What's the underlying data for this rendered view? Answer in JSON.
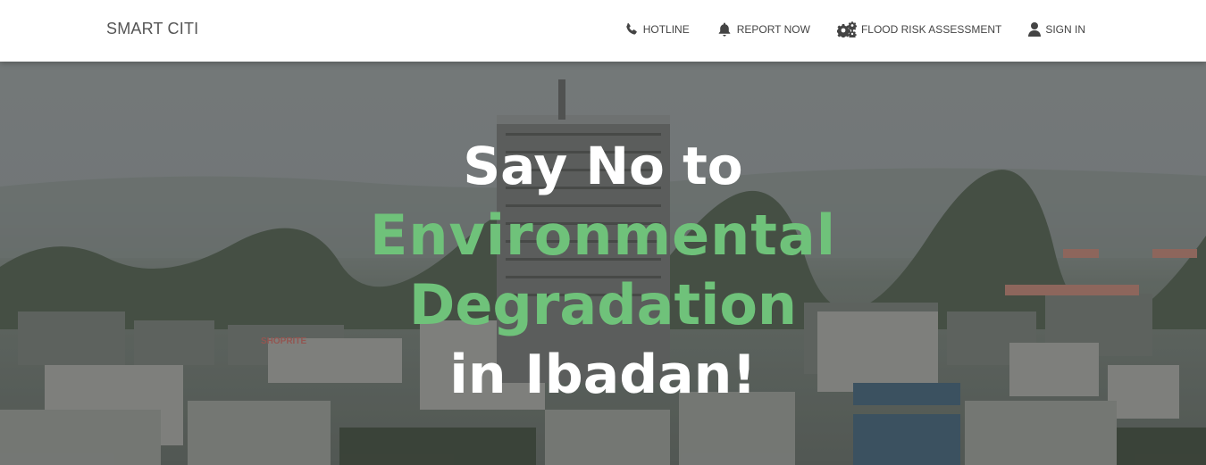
{
  "nav": {
    "brand": "SMART CITI",
    "items": [
      {
        "label": "HOTLINE",
        "icon": "phone-icon"
      },
      {
        "label": "REPORT NOW",
        "icon": "bell-icon"
      },
      {
        "label": "FLOOD RISK ASSESSMENT",
        "icon": "gears-icon"
      },
      {
        "label": "SIGN IN",
        "icon": "user-icon"
      }
    ]
  },
  "hero": {
    "line1": "Say No to",
    "line2": "Environmental",
    "line3": "Degradation",
    "line4": "in Ibadan!",
    "background": "city-skyline-image",
    "accent_color": "#6fc27a"
  }
}
